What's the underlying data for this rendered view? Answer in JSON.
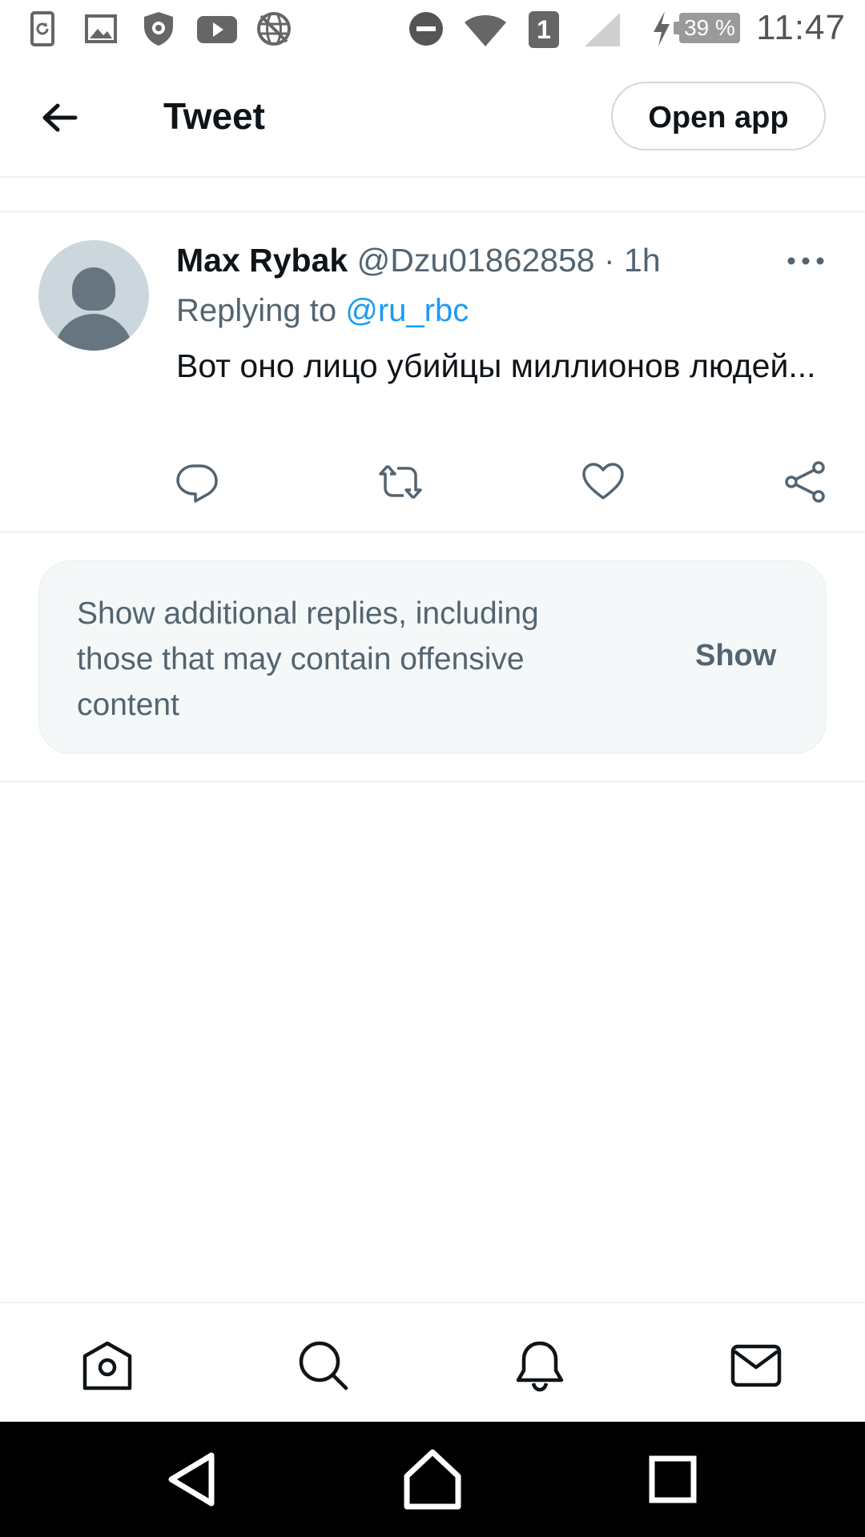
{
  "status_bar": {
    "time": "11:47",
    "battery": "39 %",
    "sim": "1",
    "icons": [
      "screen-rotate-icon",
      "image-icon",
      "shield-icon",
      "youtube-icon",
      "vpn-globe-icon",
      "do-not-disturb-icon",
      "wifi-icon",
      "sim-icon",
      "signal-icon",
      "charging-icon",
      "battery-icon"
    ]
  },
  "header": {
    "title": "Tweet",
    "open_app_label": "Open app"
  },
  "tweet": {
    "author_name": "Max Rybak",
    "author_handle": "@Dzu01862858",
    "time_separator": " · ",
    "time": "1h",
    "replying_prefix": "Replying to ",
    "replying_to": "@ru_rbc",
    "text": "Вот оно лицо убийцы миллионов людей..."
  },
  "more_replies": {
    "text": "Show additional replies, including those that may contain offensive content",
    "button_label": "Show"
  },
  "colors": {
    "accent": "#1d9bf0",
    "secondary_text": "#536471",
    "primary_text": "#0f1419",
    "divider": "#eff3f4"
  }
}
